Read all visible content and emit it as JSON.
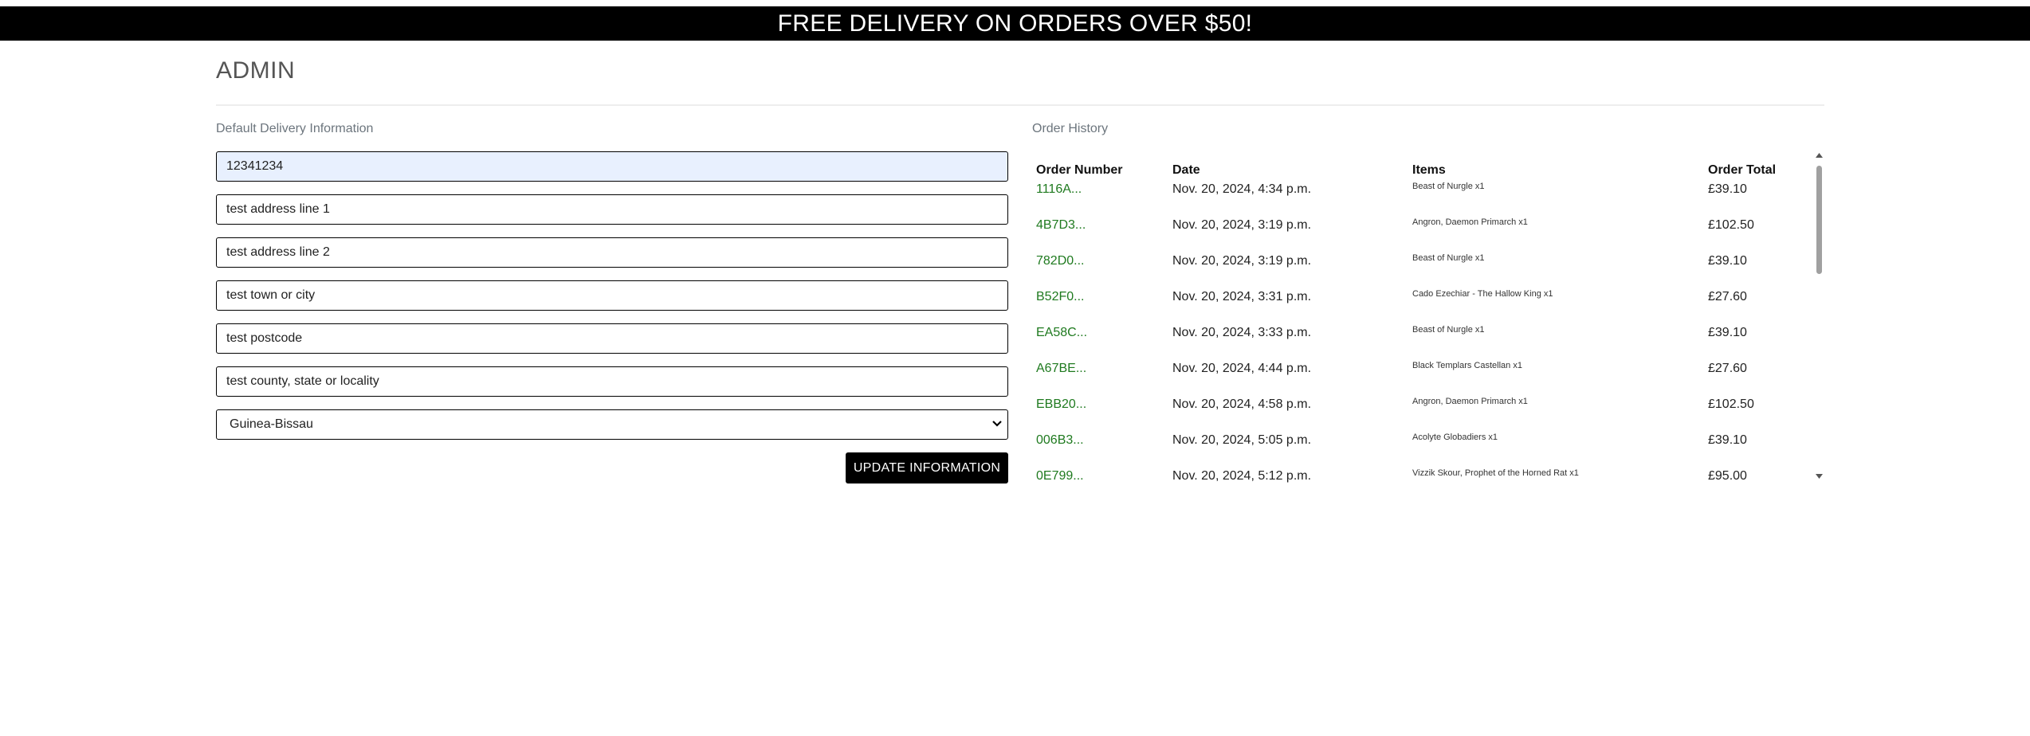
{
  "banner": {
    "text": "FREE DELIVERY ON ORDERS OVER $50!"
  },
  "page": {
    "title": "ADMIN"
  },
  "delivery": {
    "label": "Default Delivery Information",
    "phone": "12341234",
    "address_line_1": "test address line 1",
    "address_line_2": "test address line 2",
    "town_or_city": "test town or city",
    "postcode": "test postcode",
    "county": "test county, state or locality",
    "country": "Guinea-Bissau",
    "update_button": "UPDATE INFORMATION"
  },
  "orders": {
    "label": "Order History",
    "headers": {
      "number": "Order Number",
      "date": "Date",
      "items": "Items",
      "total": "Order Total"
    },
    "rows": [
      {
        "number": "1116A...",
        "date": "Nov. 20, 2024, 4:34 p.m.",
        "items": "Beast of Nurgle x1",
        "total": "£39.10"
      },
      {
        "number": "4B7D3...",
        "date": "Nov. 20, 2024, 3:19 p.m.",
        "items": "Angron, Daemon Primarch x1",
        "total": "£102.50"
      },
      {
        "number": "782D0...",
        "date": "Nov. 20, 2024, 3:19 p.m.",
        "items": "Beast of Nurgle x1",
        "total": "£39.10"
      },
      {
        "number": "B52F0...",
        "date": "Nov. 20, 2024, 3:31 p.m.",
        "items": "Cado Ezechiar - The Hallow King x1",
        "total": "£27.60"
      },
      {
        "number": "EA58C...",
        "date": "Nov. 20, 2024, 3:33 p.m.",
        "items": "Beast of Nurgle x1",
        "total": "£39.10"
      },
      {
        "number": "A67BE...",
        "date": "Nov. 20, 2024, 4:44 p.m.",
        "items": "Black Templars Castellan x1",
        "total": "£27.60"
      },
      {
        "number": "EBB20...",
        "date": "Nov. 20, 2024, 4:58 p.m.",
        "items": "Angron, Daemon Primarch x1",
        "total": "£102.50"
      },
      {
        "number": "006B3...",
        "date": "Nov. 20, 2024, 5:05 p.m.",
        "items": "Acolyte Globadiers x1",
        "total": "£39.10"
      },
      {
        "number": "0E799...",
        "date": "Nov. 20, 2024, 5:12 p.m.",
        "items": "Vizzik Skour, Prophet of the Horned Rat x1",
        "total": "£95.00"
      }
    ]
  },
  "icons": {
    "select_chevron": "chevron-down-icon",
    "scroll_up": "scroll-up-arrow-icon",
    "scroll_down": "scroll-down-arrow-icon"
  },
  "colors": {
    "banner_bg": "#000000",
    "link": "#1f7a1f",
    "autofill_bg": "#e8f0fe"
  }
}
